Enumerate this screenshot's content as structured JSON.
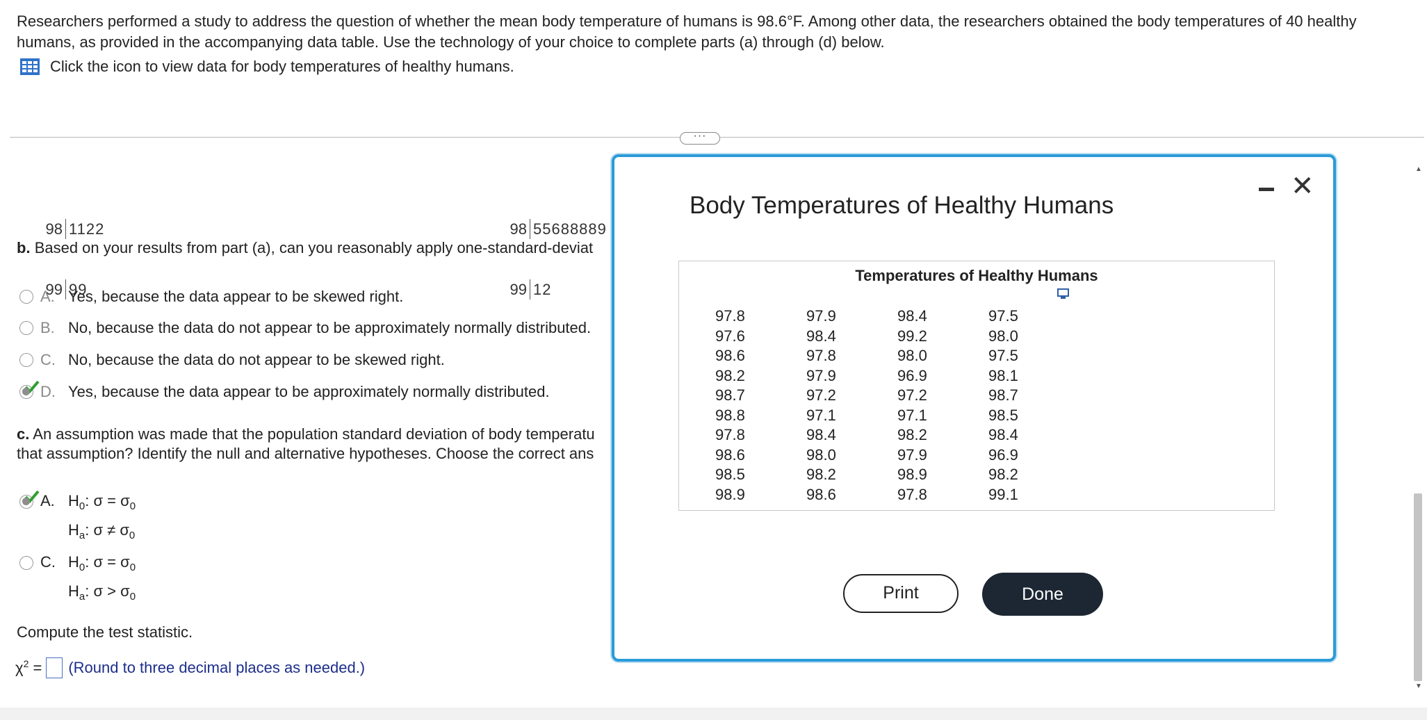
{
  "intro": {
    "text": "Researchers performed a study to address the question of whether the mean body temperature of humans is 98.6°F. Among other data, the researchers obtained the body temperatures of 40 healthy humans, as provided in the accompanying data table. Use the technology of your choice to complete parts (a) through (d) below.",
    "data_link": "Click the icon to view data for body temperatures of healthy humans.",
    "data_icon": "table-icon"
  },
  "expander_label": "···",
  "stemplot_left": {
    "rows": [
      {
        "stem": "98",
        "leaves": "1122"
      },
      {
        "stem": "99",
        "leaves": "99"
      }
    ]
  },
  "stemplot_right": {
    "rows": [
      {
        "stem": "98",
        "leaves": "55688889"
      },
      {
        "stem": "99",
        "leaves": "12"
      }
    ]
  },
  "part_b": {
    "prefix": "b.",
    "question": "Based on your results from part (a), can you reasonably apply one-standard-deviat",
    "options": [
      {
        "letter": "A.",
        "text": "Yes, because the data appear to be skewed right.",
        "state": "unselected"
      },
      {
        "letter": "B.",
        "text": "No, because the data do not appear to be approximately normally distributed.",
        "state": "unselected"
      },
      {
        "letter": "C.",
        "text": "No, because the data do not appear to be skewed right.",
        "state": "unselected"
      },
      {
        "letter": "D.",
        "text": "Yes, because the data appear to be approximately normally distributed.",
        "state": "correct"
      }
    ]
  },
  "part_c": {
    "prefix": "c.",
    "line1": "An assumption was made that the population standard deviation of body temperatu",
    "line2": "that assumption? Identify the null and alternative hypotheses. Choose the correct ans",
    "options": [
      {
        "letter": "A.",
        "h0_label": "H",
        "h0_sub": "0",
        "h0_rel": ": σ = σ",
        "h0_rel_sub": "0",
        "ha_label": "H",
        "ha_sub": "a",
        "ha_rel": ": σ ≠ σ",
        "ha_rel_sub": "0",
        "state": "correct"
      },
      {
        "letter": "C.",
        "h0_label": "H",
        "h0_sub": "0",
        "h0_rel": ": σ = σ",
        "h0_rel_sub": "0",
        "ha_label": "H",
        "ha_sub": "a",
        "ha_rel": ": σ > σ",
        "ha_rel_sub": "0",
        "state": "unselected"
      }
    ]
  },
  "compute": {
    "label": "Compute the test statistic.",
    "symbol": "χ",
    "symbol_sup": "2",
    "equals": " =",
    "value": "",
    "hint": "(Round to three decimal places as needed.)"
  },
  "modal": {
    "title": "Body Temperatures of Healthy Humans",
    "table_title": "Temperatures of Healthy Humans",
    "rows": [
      [
        "97.8",
        "97.9",
        "98.4",
        "97.5"
      ],
      [
        "97.6",
        "98.4",
        "99.2",
        "98.0"
      ],
      [
        "98.6",
        "97.8",
        "98.0",
        "97.5"
      ],
      [
        "98.2",
        "97.9",
        "96.9",
        "98.1"
      ],
      [
        "98.7",
        "97.2",
        "97.2",
        "98.7"
      ],
      [
        "98.8",
        "97.1",
        "97.1",
        "98.5"
      ],
      [
        "97.8",
        "98.4",
        "98.2",
        "98.4"
      ],
      [
        "98.6",
        "98.0",
        "97.9",
        "96.9"
      ],
      [
        "98.5",
        "98.2",
        "98.9",
        "98.2"
      ],
      [
        "98.9",
        "98.6",
        "97.8",
        "99.1"
      ]
    ],
    "print_label": "Print",
    "done_label": "Done",
    "close_glyph": "✕"
  },
  "colors": {
    "modal_border": "#2a9ad8",
    "done_bg": "#1d2733",
    "hint_text": "#1c2e8c",
    "correct_check": "#2e9e2e"
  }
}
